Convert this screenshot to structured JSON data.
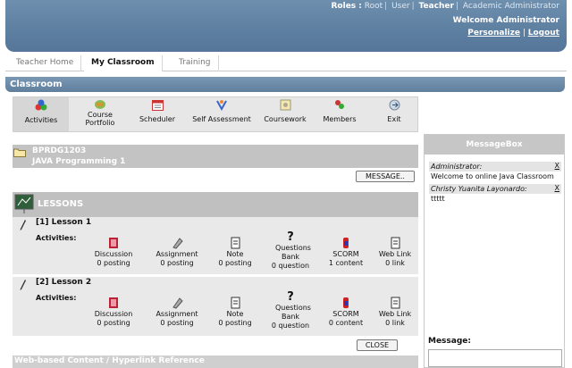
{
  "header": {
    "roles_label": "Roles :",
    "roles": [
      "Root",
      "User",
      "Teacher",
      "Academic Administrator"
    ],
    "welcome": "Welcome Administrator",
    "personalize": "Personalize",
    "logout": "Logout"
  },
  "nav": {
    "tabs": [
      "Teacher Home",
      "My Classroom",
      "Training"
    ],
    "active": "My Classroom"
  },
  "classroom_title": "Classroom",
  "toolbar": {
    "items": [
      {
        "label": "Activities",
        "icon": "activities-icon"
      },
      {
        "label": "Course Portfolio",
        "icon": "portfolio-icon"
      },
      {
        "label": "Scheduler",
        "icon": "calendar-icon"
      },
      {
        "label": "Self Assessment",
        "icon": "assessment-icon"
      },
      {
        "label": "Coursework",
        "icon": "coursework-icon"
      },
      {
        "label": "Members",
        "icon": "members-icon"
      },
      {
        "label": "Exit",
        "icon": "exit-icon"
      }
    ]
  },
  "course": {
    "code": "BPRDG1203",
    "name": "JAVA Programming 1"
  },
  "message_button": "MESSAGE..",
  "lessons_title": "LESSONS",
  "activities_label": "Activities:",
  "lessons": [
    {
      "title": "[1] Lesson 1",
      "activities": [
        {
          "name": "Discussion",
          "count": "0 posting"
        },
        {
          "name": "Assignment",
          "count": "0 posting"
        },
        {
          "name": "Note",
          "count": "0 posting"
        },
        {
          "name": "Questions Bank",
          "count": "0 question"
        },
        {
          "name": "SCORM",
          "count": "1 content"
        },
        {
          "name": "Web Link",
          "count": "0 link"
        }
      ]
    },
    {
      "title": "[2] Lesson 2",
      "activities": [
        {
          "name": "Discussion",
          "count": "0 posting"
        },
        {
          "name": "Assignment",
          "count": "0 posting"
        },
        {
          "name": "Note",
          "count": "0 posting"
        },
        {
          "name": "Questions Bank",
          "count": "0 question"
        },
        {
          "name": "SCORM",
          "count": "0 content"
        },
        {
          "name": "Web Link",
          "count": "0 link"
        }
      ]
    }
  ],
  "close_button": "CLOSE",
  "reference_title": "Web-based Content / Hyperlink Reference",
  "messagebox": {
    "title": "MessageBox",
    "messages": [
      {
        "from": "Administrator:",
        "text": "Welcome to online Java Classroom",
        "delete": "X"
      },
      {
        "from": "Christy Yuanita Layonardo:",
        "text": "ttttt",
        "delete": "X"
      }
    ],
    "message_label": "Message:"
  },
  "colors": {
    "header": "#5d7fa0",
    "section_gray": "#c3c3c3",
    "row_gray": "#e9e9e9"
  }
}
